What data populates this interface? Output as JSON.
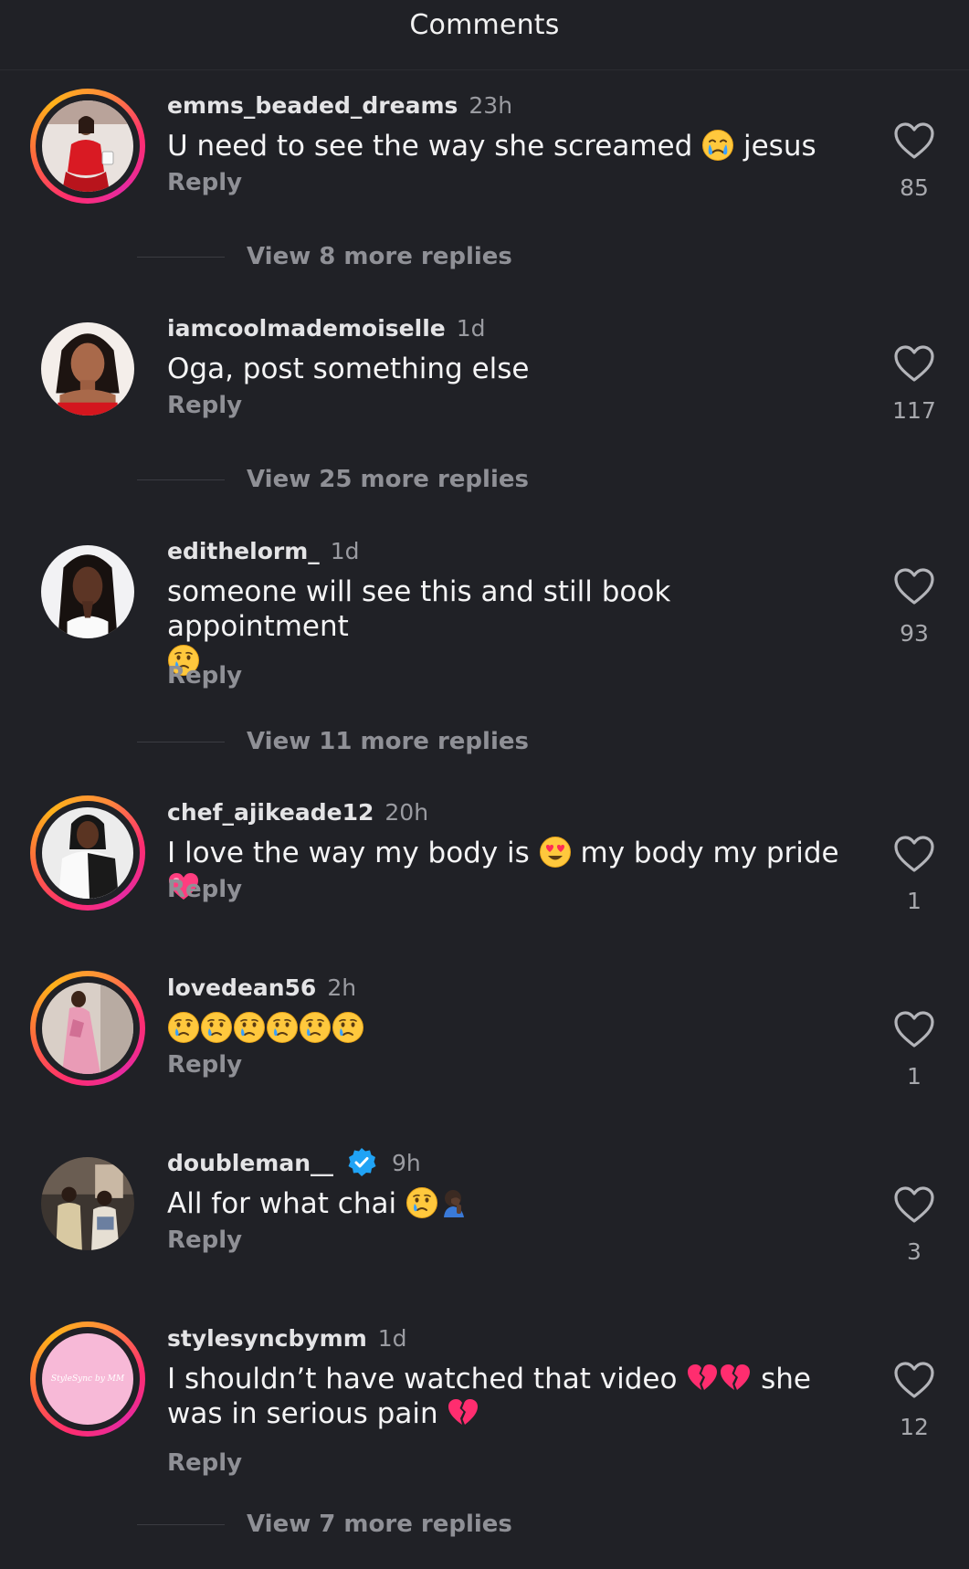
{
  "header": {
    "title": "Comments"
  },
  "reply_label": "Reply",
  "comments": [
    {
      "username": "emms_beaded_dreams",
      "time": "23h",
      "text_before": "U need to see the way she screamed ",
      "text_after": " jesus",
      "likes": "85",
      "view_replies": "View 8 more replies",
      "avatar_icon": "woman-red-dress-avatar"
    },
    {
      "username": "iamcoolmademoiselle",
      "time": "1d",
      "text": "Oga, post something else",
      "likes": "117",
      "view_replies": "View 25 more replies",
      "avatar_icon": "woman-portrait-avatar"
    },
    {
      "username": "edithelorm_",
      "time": "1d",
      "text": "someone will see this and still book appointment",
      "likes": "93",
      "view_replies": "View 11 more replies",
      "avatar_icon": "woman-portrait-avatar"
    },
    {
      "username": "chef_ajikeade12",
      "time": "20h",
      "text_before": "I love the way my body is ",
      "text_middle": " my body my pride ",
      "likes": "1",
      "avatar_icon": "woman-black-white-outfit-avatar"
    },
    {
      "username": "lovedean56",
      "time": "2h",
      "likes": "1",
      "avatar_icon": "woman-pink-dress-avatar"
    },
    {
      "username": "doubleman__",
      "time": "9h",
      "text_before": "All for what chai ",
      "likes": "3",
      "avatar_icon": "two-men-avatar"
    },
    {
      "username": "stylesyncbymm",
      "time": "1d",
      "text_before": "I shouldn’t have watched that video ",
      "text_middle": " she was in serious pain ",
      "likes": "12",
      "view_replies": "View 7 more replies",
      "avatar_icon": "pink-logo-avatar",
      "avatar_text": "StyleSync by MM"
    }
  ],
  "colors": {
    "background": "#202126",
    "username": "#e4e4e6",
    "muted": "#8f9096",
    "story_ring_start": "#ff2d6f",
    "story_ring_end": "#ffb21a",
    "verified": "#20a3f5"
  }
}
